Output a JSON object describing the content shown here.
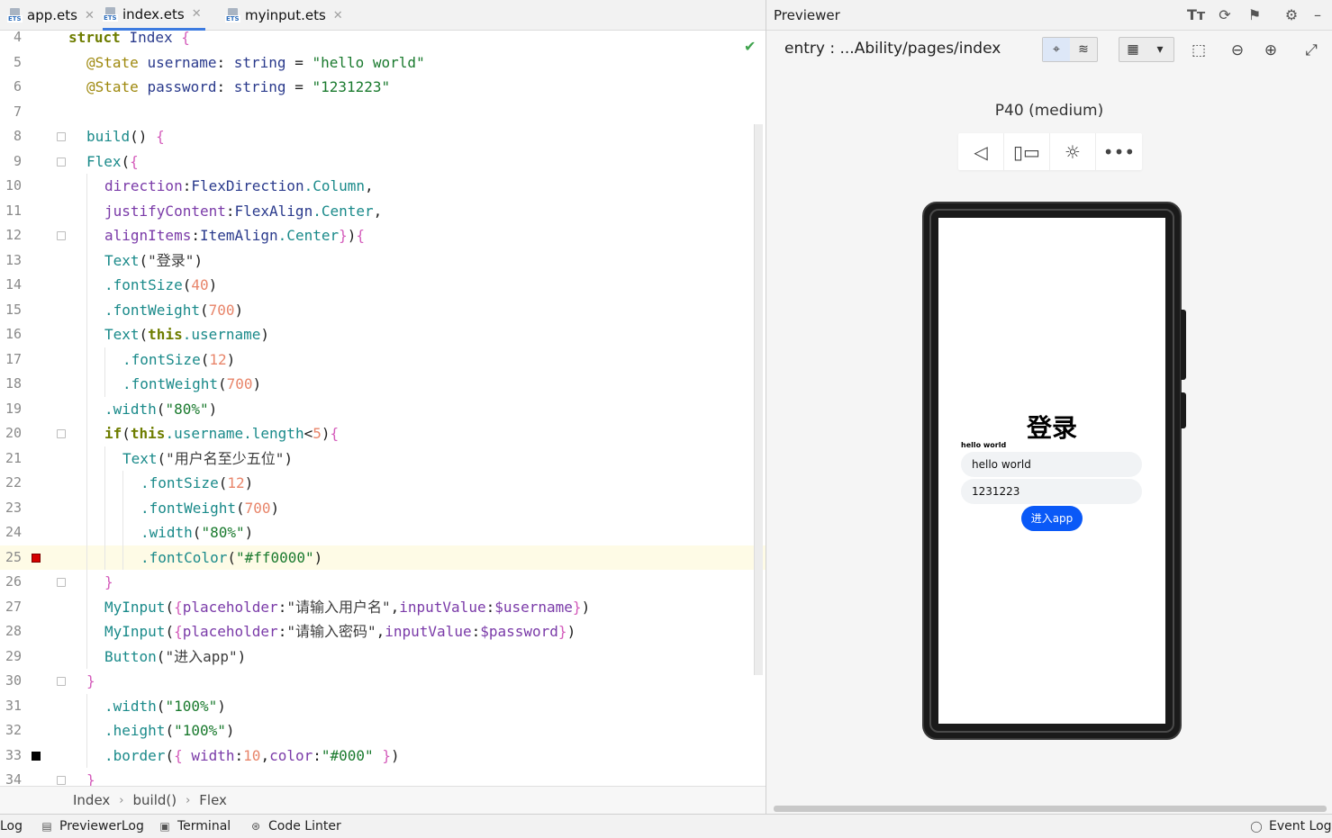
{
  "tabs": [
    {
      "name": "app.ets",
      "icon_label": "ETS",
      "active": false
    },
    {
      "name": "index.ets",
      "icon_label": "ETS",
      "active": true
    },
    {
      "name": "myinput.ets",
      "icon_label": "ETS",
      "active": false
    }
  ],
  "code_lines": [
    {
      "num": "4",
      "code": "struct Index {"
    },
    {
      "num": "5",
      "code": "@State username: string = \"hello world\""
    },
    {
      "num": "6",
      "code": "@State password: string = \"1231223\""
    },
    {
      "num": "7",
      "code": ""
    },
    {
      "num": "8",
      "code": "build() {"
    },
    {
      "num": "9",
      "code": "Flex({"
    },
    {
      "num": "10",
      "code": "direction:FlexDirection.Column,"
    },
    {
      "num": "11",
      "code": "justifyContent:FlexAlign.Center,"
    },
    {
      "num": "12",
      "code": "alignItems:ItemAlign.Center}){"
    },
    {
      "num": "13",
      "code": "Text(\"登录\")"
    },
    {
      "num": "14",
      "code": ".fontSize(40)"
    },
    {
      "num": "15",
      "code": ".fontWeight(700)"
    },
    {
      "num": "16",
      "code": "Text(this.username)"
    },
    {
      "num": "17",
      "code": ".fontSize(12)"
    },
    {
      "num": "18",
      "code": ".fontWeight(700)"
    },
    {
      "num": "19",
      "code": ".width(\"80%\")"
    },
    {
      "num": "20",
      "code": "if(this.username.length<5){"
    },
    {
      "num": "21",
      "code": "Text(\"用户名至少五位\")"
    },
    {
      "num": "22",
      "code": ".fontSize(12)"
    },
    {
      "num": "23",
      "code": ".fontWeight(700)"
    },
    {
      "num": "24",
      "code": ".width(\"80%\")"
    },
    {
      "num": "25",
      "code": ".fontColor(\"#ff0000\")"
    },
    {
      "num": "26",
      "code": "}"
    },
    {
      "num": "27",
      "code": "MyInput({placeholder:\"请输入用户名\",inputValue:$username})"
    },
    {
      "num": "28",
      "code": "MyInput({placeholder:\"请输入密码\",inputValue:$password})"
    },
    {
      "num": "29",
      "code": "Button(\"进入app\")"
    },
    {
      "num": "30",
      "code": "}"
    },
    {
      "num": "31",
      "code": ".width(\"100%\")"
    },
    {
      "num": "32",
      "code": ".height(\"100%\")"
    },
    {
      "num": "33",
      "code": ".border({ width:10,color:\"#000\" })"
    },
    {
      "num": "34",
      "code": "}"
    }
  ],
  "breadcrumb": [
    "Index",
    "build()",
    "Flex"
  ],
  "previewer": {
    "title": "Previewer",
    "entry_label": "entry : ...Ability/pages/index",
    "device_name": "P40 (medium)"
  },
  "app_preview": {
    "title": "登录",
    "username_label": "hello world",
    "input_username": "hello world",
    "input_password": "1231223",
    "button_label": "进入app"
  },
  "bottom_bar": {
    "log": "Log",
    "previewer_log": "PreviewerLog",
    "terminal": "Terminal",
    "code_linter": "Code Linter",
    "event_log": "Event Log"
  },
  "colors": {
    "accent_blue": "#0a59f7",
    "tab_active_underline": "#3d7be0",
    "breakpoint_red": "#d40000",
    "check_green": "#3fa34d"
  }
}
